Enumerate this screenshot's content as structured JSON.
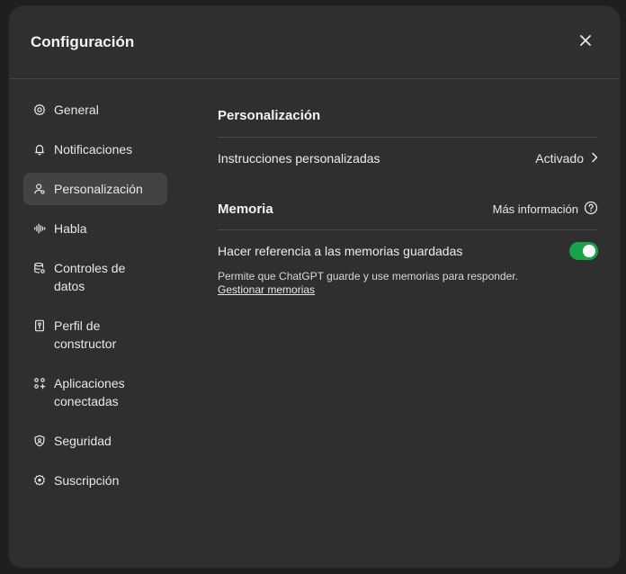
{
  "dialog": {
    "title": "Configuración"
  },
  "sidebar": {
    "items": [
      {
        "label": "General",
        "icon": "gear-icon"
      },
      {
        "label": "Notificaciones",
        "icon": "bell-icon"
      },
      {
        "label": "Personalización",
        "icon": "user-icon"
      },
      {
        "label": "Habla",
        "icon": "waveform-icon"
      },
      {
        "label": "Controles de datos",
        "icon": "database-gear-icon"
      },
      {
        "label": "Perfil de constructor",
        "icon": "id-card-icon"
      },
      {
        "label": "Aplicaciones conectadas",
        "icon": "apps-plus-icon"
      },
      {
        "label": "Seguridad",
        "icon": "shield-icon"
      },
      {
        "label": "Suscripción",
        "icon": "subscription-icon"
      }
    ],
    "active_index": 2
  },
  "personalization": {
    "title": "Personalización",
    "custom_instructions_label": "Instrucciones personalizadas",
    "custom_instructions_status": "Activado"
  },
  "memory": {
    "title": "Memoria",
    "more_info_label": "Más información",
    "reference_label": "Hacer referencia a las memorias guardadas",
    "reference_enabled": true,
    "description": "Permite que ChatGPT guarde y use memorias para responder.",
    "manage_link": "Gestionar memorias"
  },
  "colors": {
    "modal_bg": "#2f2f2f",
    "active_item_bg": "#434343",
    "toggle_on": "#17a34a"
  }
}
